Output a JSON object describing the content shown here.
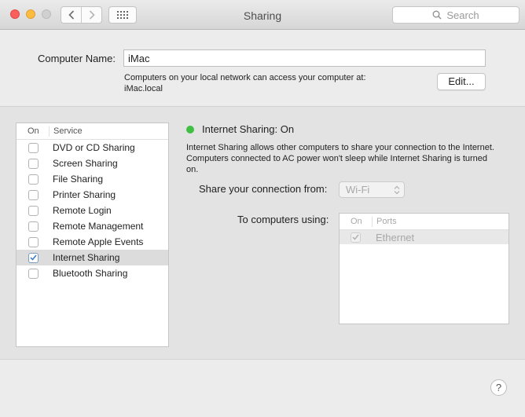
{
  "window": {
    "title": "Sharing",
    "search_placeholder": "Search"
  },
  "computer_name": {
    "label": "Computer Name:",
    "value": "iMac",
    "description_line1": "Computers on your local network can access your computer at:",
    "description_line2": "iMac.local",
    "edit_label": "Edit..."
  },
  "services": {
    "header_on": "On",
    "header_service": "Service",
    "items": [
      {
        "label": "DVD or CD Sharing",
        "checked": false
      },
      {
        "label": "Screen Sharing",
        "checked": false
      },
      {
        "label": "File Sharing",
        "checked": false
      },
      {
        "label": "Printer Sharing",
        "checked": false
      },
      {
        "label": "Remote Login",
        "checked": false
      },
      {
        "label": "Remote Management",
        "checked": false
      },
      {
        "label": "Remote Apple Events",
        "checked": false
      },
      {
        "label": "Internet Sharing",
        "checked": true,
        "selected": true
      },
      {
        "label": "Bluetooth Sharing",
        "checked": false
      }
    ]
  },
  "detail": {
    "status_title": "Internet Sharing: On",
    "status_color": "#3fc043",
    "description": "Internet Sharing allows other computers to share your connection to the Internet. Computers connected to AC power won't sleep while Internet Sharing is turned on.",
    "share_from_label": "Share your connection from:",
    "share_from_value": "Wi-Fi",
    "to_computers_label": "To computers using:",
    "ports_header_on": "On",
    "ports_header_ports": "Ports",
    "ports": [
      {
        "label": "Ethernet",
        "checked": true
      }
    ]
  },
  "help_label": "?"
}
